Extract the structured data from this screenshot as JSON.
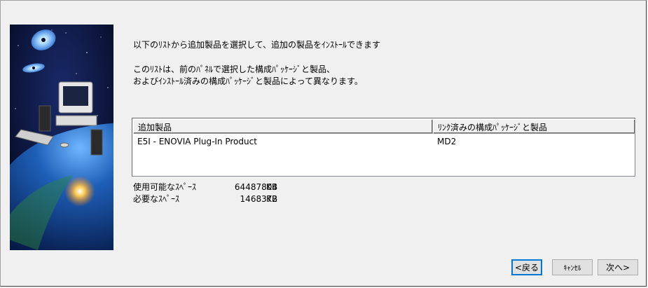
{
  "intro": {
    "line1": "以下のﾘｽﾄから追加製品を選択して、追加の製品をｲﾝｽﾄｰﾙできます",
    "line2": "このﾘｽﾄは、前のﾊﾟﾈﾙで選択した構成ﾊﾟｯｹｰｼﾞと製品、",
    "line3": "およびｲﾝｽﾄｰﾙ済みの構成ﾊﾟｯｹｰｼﾞと製品によって異なります。"
  },
  "table": {
    "columns": [
      "追加製品",
      "ﾘﾝｸ済みの構成ﾊﾟｯｹｰｼﾞと製品"
    ],
    "rows": [
      [
        "E5I - ENOVIA Plug-In Product",
        "MD2"
      ]
    ]
  },
  "space": {
    "available_label": "使用可能なｽﾍﾟｰｽ",
    "available_value": "64487804",
    "required_label": "必要なｽﾍﾟｰｽ",
    "required_value": "1468372",
    "unit": "KB"
  },
  "buttons": {
    "back": "<戻る",
    "cancel": "ｷｬﾝｾﾙ",
    "next": "次へ>"
  },
  "banner": {
    "icons": [
      "cd-disc-icon",
      "computer-icon",
      "earth-icon"
    ]
  }
}
